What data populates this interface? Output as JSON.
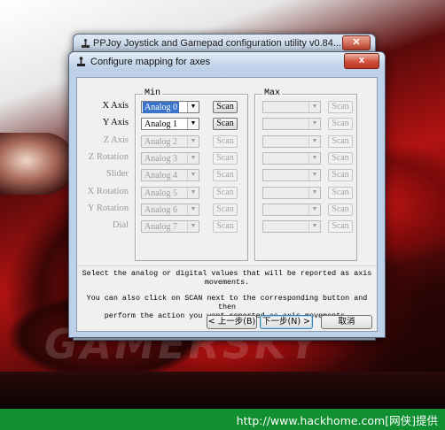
{
  "parent_window": {
    "title": "PPJoy Joystick and Gamepad configuration utility  v0.84..."
  },
  "dialog": {
    "title": "Configure mapping for axes",
    "close_label": "x",
    "min_group_label": "Min",
    "max_group_label": "Max",
    "axes": [
      {
        "label": "X Axis",
        "min_value": "Analog 0",
        "max_value": "",
        "enabled": true,
        "selected": true
      },
      {
        "label": "Y Axis",
        "min_value": "Analog 1",
        "max_value": "",
        "enabled": true,
        "selected": false
      },
      {
        "label": "Z Axis",
        "min_value": "Analog 2",
        "max_value": "",
        "enabled": false
      },
      {
        "label": "Z Rotation",
        "min_value": "Analog 3",
        "max_value": "",
        "enabled": false
      },
      {
        "label": "Slider",
        "min_value": "Analog 4",
        "max_value": "",
        "enabled": false
      },
      {
        "label": "X Rotation",
        "min_value": "Analog 5",
        "max_value": "",
        "enabled": false
      },
      {
        "label": "Y Rotation",
        "min_value": "Analog 6",
        "max_value": "",
        "enabled": false
      },
      {
        "label": "Dial",
        "min_value": "Analog 7",
        "max_value": "",
        "enabled": false
      }
    ],
    "scan_label": "Scan",
    "instruction_line1": "Select the analog or digital values that will be reported as axis",
    "instruction_line2": "movements.",
    "instruction_line3": "You can also click on SCAN next to the corresponding button and then",
    "instruction_line4": "perform the action you want reported as axis movements.",
    "back_button": "< 上一步(B)",
    "next_button": "下一步(N) >",
    "cancel_button": "取消"
  },
  "background": {
    "watermark": "GAMERSKY",
    "status_text": "http://www.hackhome.com[网侠]提供"
  },
  "colors": {
    "selection": "#3a73c8",
    "status_bar": "#0f8f2f",
    "car_red": "#c51515"
  }
}
